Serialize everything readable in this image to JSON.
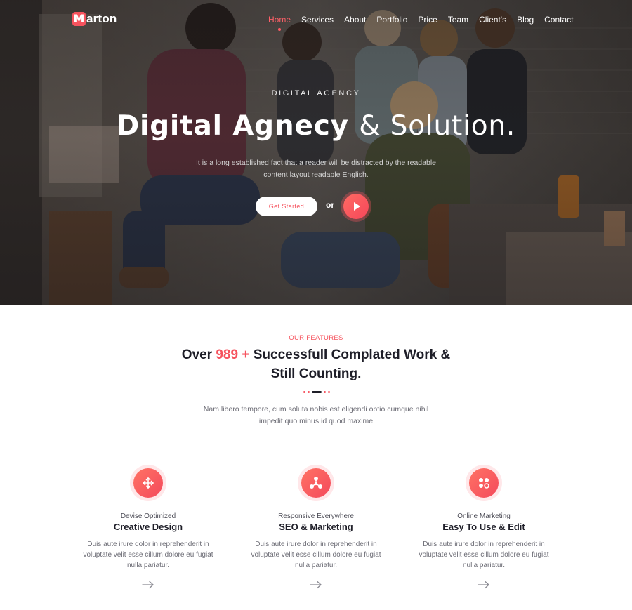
{
  "brand": {
    "logo_letter": "M",
    "logo_rest": "arton",
    "accent": "#f6535e"
  },
  "nav": {
    "items": [
      "Home",
      "Services",
      "About",
      "Portfolio",
      "Price",
      "Team",
      "Client's",
      "Blog",
      "Contact"
    ],
    "active": "Home"
  },
  "hero": {
    "kicker": "DIGITAL AGENCY",
    "title_bold": "Digital Agnecy",
    "title_light": "& Solution.",
    "subtitle": "It is a long established fact that a reader will be distracted by the readable content layout readable English.",
    "cta_label": "Get Started",
    "or_label": "or",
    "play_icon": "play-icon"
  },
  "features": {
    "kicker": "OUR FEATURES",
    "title_before": "Over",
    "title_count": "989 +",
    "title_after": "Successfull Complated Work & Still Counting.",
    "description": "Nam libero tempore, cum soluta nobis est eligendi optio cumque nihil impedit quo minus id quod maxime",
    "items": [
      {
        "kicker": "Devise Optimized",
        "title": "Creative Design",
        "text": "Duis aute irure dolor in reprehenderit in voluptate velit esse cillum dolore eu fugiat nulla pariatur.",
        "icon": "move-arrows-icon"
      },
      {
        "kicker": "Responsive Everywhere",
        "title": "SEO & Marketing",
        "text": "Duis aute irure dolor in reprehenderit in voluptate velit esse cillum dolore eu fugiat nulla pariatur.",
        "icon": "network-nodes-icon"
      },
      {
        "kicker": "Online Marketing",
        "title": "Easy To Use & Edit",
        "text": "Duis aute irure dolor in reprehenderit in voluptate velit esse cillum dolore eu fugiat nulla pariatur.",
        "icon": "apps-grid-icon"
      }
    ]
  }
}
